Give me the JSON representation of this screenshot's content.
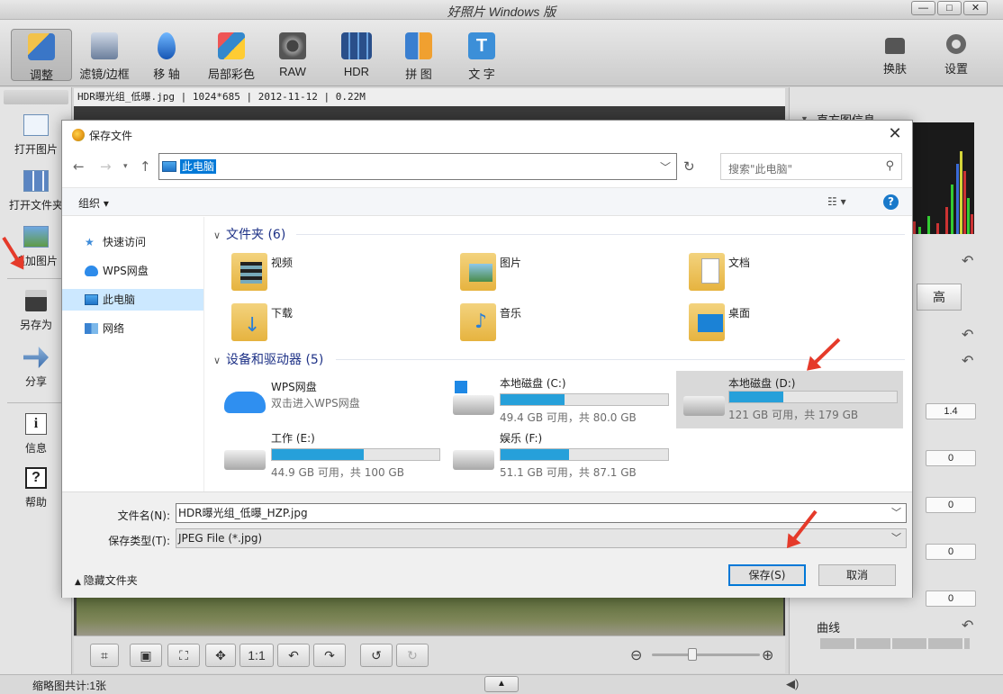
{
  "app": {
    "title": "好照片 Windows 版",
    "window_controls": [
      "—",
      "□",
      "✕"
    ]
  },
  "toolbar": {
    "items": [
      {
        "label": "调整",
        "icon": "brush-ruler-icon",
        "active": true
      },
      {
        "label": "滤镜/边框",
        "icon": "paint-bucket-icon"
      },
      {
        "label": "移 轴",
        "icon": "water-drop-icon"
      },
      {
        "label": "局部彩色",
        "icon": "color-pencil-icon"
      },
      {
        "label": "RAW",
        "icon": "camera-icon"
      },
      {
        "label": "HDR",
        "icon": "film-strip-icon"
      },
      {
        "label": "拼 图",
        "icon": "collage-icon"
      },
      {
        "label": "文 字",
        "icon": "text-t-icon"
      }
    ],
    "right": [
      {
        "label": "换肤",
        "icon": "tshirt-icon"
      },
      {
        "label": "设置",
        "icon": "gear-icon"
      }
    ]
  },
  "sidebar": {
    "items": [
      {
        "label": "打开图片",
        "icon": "open-image-icon"
      },
      {
        "label": "打开文件夹",
        "icon": "open-folder-icon"
      },
      {
        "label": "追加图片",
        "icon": "add-image-icon"
      },
      {
        "label": "另存为",
        "icon": "save-as-icon"
      },
      {
        "label": "分享",
        "icon": "share-icon"
      },
      {
        "label": "信息",
        "icon": "info-icon"
      },
      {
        "label": "帮助",
        "icon": "help-icon"
      }
    ]
  },
  "image_info": "HDR曝光组_低曝.jpg | 1024*685 | 2012-11-12 | 0.22M",
  "right_panel": {
    "histogram_title": "直方图信息",
    "tab_high": "高",
    "values": [
      "1.4",
      "0",
      "0",
      "0",
      "0"
    ],
    "curve_label": "曲线"
  },
  "bottom_tools": {
    "one_to_one": "1:1"
  },
  "status": {
    "thumb_count": "缩略图共计:1张"
  },
  "dialog": {
    "title": "保存文件",
    "address": "此电脑",
    "search_placeholder": "搜索\"此电脑\"",
    "organize": "组织 ▾",
    "nav": [
      {
        "label": "快速访问",
        "icon": "star-icon"
      },
      {
        "label": "WPS网盘",
        "icon": "cloud-icon"
      },
      {
        "label": "此电脑",
        "icon": "computer-icon",
        "selected": true
      },
      {
        "label": "网络",
        "icon": "network-icon"
      }
    ],
    "folders_header": "文件夹 (6)",
    "folders": [
      {
        "name": "视频",
        "icon": "video-folder-icon"
      },
      {
        "name": "图片",
        "icon": "pictures-folder-icon"
      },
      {
        "name": "文档",
        "icon": "documents-folder-icon"
      },
      {
        "name": "下载",
        "icon": "downloads-folder-icon"
      },
      {
        "name": "音乐",
        "icon": "music-folder-icon"
      },
      {
        "name": "桌面",
        "icon": "desktop-folder-icon"
      }
    ],
    "drives_header": "设备和驱动器 (5)",
    "drives": [
      {
        "name": "WPS网盘",
        "sub": "双击进入WPS网盘",
        "icon": "cloud-drive-icon"
      },
      {
        "name": "本地磁盘 (C:)",
        "sub": "49.4 GB 可用，共 80.0 GB",
        "used": 0.38,
        "icon": "windows-drive-icon"
      },
      {
        "name": "本地磁盘 (D:)",
        "sub": "121 GB 可用，共 179 GB",
        "used": 0.32,
        "icon": "hard-drive-icon",
        "selected": true
      },
      {
        "name": "工作 (E:)",
        "sub": "44.9 GB 可用，共 100 GB",
        "used": 0.55,
        "icon": "hard-drive-icon"
      },
      {
        "name": "娱乐 (F:)",
        "sub": "51.1 GB 可用，共 87.1 GB",
        "used": 0.41,
        "icon": "hard-drive-icon"
      }
    ],
    "filename_label": "文件名(N):",
    "filename_value": "HDR曝光组_低曝_HZP.jpg",
    "filetype_label": "保存类型(T):",
    "filetype_value": "JPEG File (*.jpg)",
    "hide_folders": "隐藏文件夹",
    "save_button": "保存(S)",
    "cancel_button": "取消"
  },
  "colors": {
    "accent": "#0078d7",
    "drive_bar": "#26a0da",
    "annotation_arrow": "#e53a2a"
  }
}
